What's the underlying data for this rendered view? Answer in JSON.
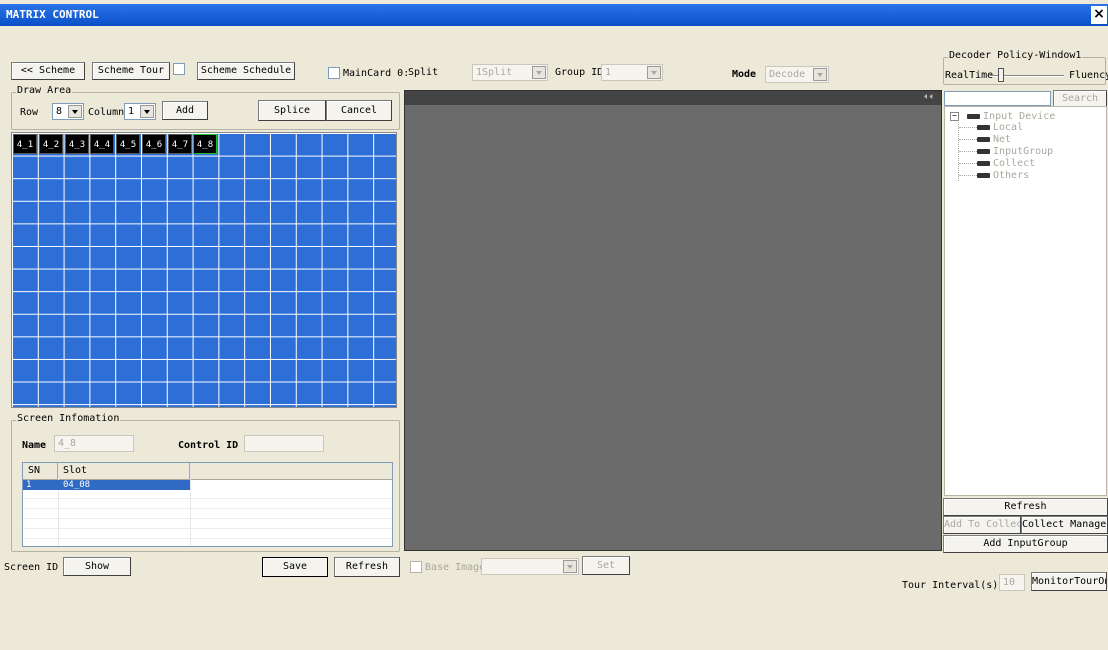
{
  "window": {
    "title": "MATRIX CONTROL",
    "close_symbol": "×"
  },
  "toolbar": {
    "scheme": "<< Scheme",
    "scheme_tour": "Scheme Tour",
    "scheme_schedule": "Scheme Schedule",
    "maincard_label": "MainCard 0:",
    "split_label": "Split",
    "split_value": "1Split",
    "group_id_label": "Group ID",
    "group_id_value": "1",
    "mode_label": "Mode",
    "mode_value": "Decode"
  },
  "draw_area": {
    "title": "Draw Area",
    "row_label": "Row",
    "row_value": "8",
    "column_label": "Column",
    "column_value": "1",
    "add": "Add",
    "splice": "Splice",
    "cancel": "Cancel",
    "cells": [
      "4_1",
      "4_2",
      "4_3",
      "4_4",
      "4_5",
      "4_6",
      "4_7",
      "4_8"
    ]
  },
  "screen_info": {
    "title": "Screen Infomation",
    "name_label": "Name",
    "name_value": "4_8",
    "control_id_label": "Control ID",
    "control_id_value": "",
    "columns": [
      "SN",
      "Slot"
    ],
    "rows": [
      {
        "sn": "1",
        "slot": "04_08"
      }
    ]
  },
  "bottom": {
    "screen_id": "Screen ID",
    "show": "Show",
    "save": "Save",
    "refresh": "Refresh",
    "base_image": "Base Image",
    "set": "Set",
    "tour_interval_label": "Tour Interval(s)",
    "tour_interval_value": "10",
    "monitor_tour": "MonitorTourOn"
  },
  "decoder": {
    "title": "Decoder Policy-Window1",
    "realtime": "RealTime",
    "fluency": "Fluency",
    "slider_level": 0.15
  },
  "search": {
    "button": "Search",
    "value": ""
  },
  "tree": {
    "root": "Input Device",
    "children": [
      "Local",
      "Net",
      "InputGroup",
      "Collect",
      "Others"
    ]
  },
  "right_buttons": {
    "refresh": "Refresh",
    "add_to_collect": "Add To Collect",
    "collect_manager": "Collect Manager",
    "add_inputgroup": "Add InputGroup"
  },
  "video": {
    "audio_icon": "speaker-icon"
  }
}
